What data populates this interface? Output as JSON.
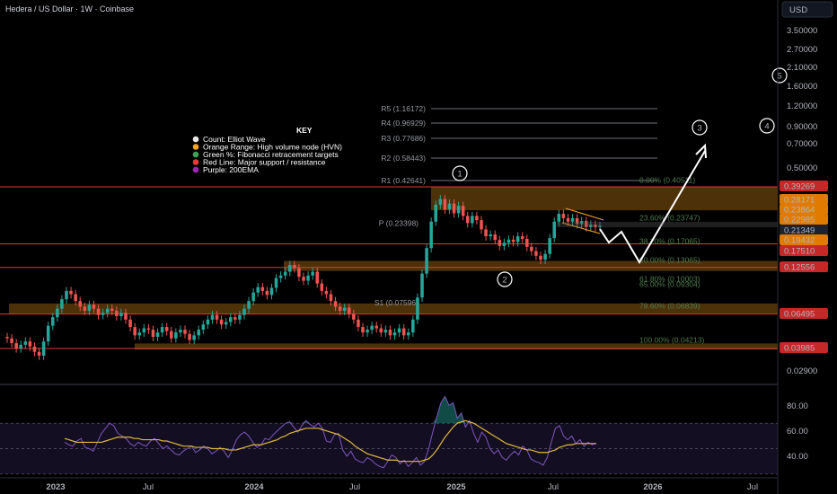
{
  "header": {
    "title": "Hedera / US Dollar · 1W · Coinbase",
    "currency": "USD"
  },
  "chart_data": {
    "type": "candlestick",
    "title": "Hedera / US Dollar · 1W · Coinbase",
    "y_scale": "log",
    "ylim": [
      0.025,
      4.2
    ],
    "x_ticks": [
      "2023",
      "Jul",
      "2024",
      "Jul",
      "2025",
      "Jul",
      "2026",
      "Jul"
    ],
    "y_ticks": [
      "3.50000",
      "2.70000",
      "2.10000",
      "1.60000",
      "1.20000",
      "0.90000",
      "0.70000",
      "0.50000",
      "0.02900"
    ],
    "price_badges": [
      {
        "value": "0.39269",
        "kind": "red"
      },
      {
        "value": "0.28171",
        "kind": "orange"
      },
      {
        "value": "0.23864",
        "kind": "orange"
      },
      {
        "value": "0.22985",
        "kind": "orange"
      },
      {
        "value": "0.21349",
        "kind": "dark"
      },
      {
        "value": "0.19432",
        "kind": "orange"
      },
      {
        "value": "0.17510",
        "kind": "red"
      },
      {
        "value": "0.12556",
        "kind": "red"
      },
      {
        "value": "0.06495",
        "kind": "red"
      },
      {
        "value": "0.03985",
        "kind": "red"
      }
    ],
    "support_resistance_lines": [
      0.39269,
      0.1751,
      0.12556,
      0.06495,
      0.03985
    ],
    "hvn_zones": [
      {
        "from": 0.2817,
        "to": 0.3927
      },
      {
        "from": 0.1194,
        "to": 0.1376
      },
      {
        "from": 0.0653,
        "to": 0.0753
      },
      {
        "from": 0.0392,
        "to": 0.0428
      }
    ],
    "pivot_levels": [
      {
        "label": "R5 (1.16172)",
        "value": 1.16172
      },
      {
        "label": "R4 (0.96929)",
        "value": 0.96929
      },
      {
        "label": "R3 (0.77686)",
        "value": 0.77686
      },
      {
        "label": "R2 (0.58443)",
        "value": 0.58443
      },
      {
        "label": "R1 (0.42641)",
        "value": 0.42641
      },
      {
        "label": "P (0.23398)",
        "value": 0.23398
      },
      {
        "label": "S1 (0.07596)",
        "value": 0.07596
      }
    ],
    "fib_levels": [
      {
        "label": "0.00% (0.40511)",
        "value": 0.40511
      },
      {
        "label": "23.60% (0.23747)",
        "value": 0.23747
      },
      {
        "label": "38.20% (0.17065)",
        "value": 0.17065
      },
      {
        "label": "50.00% (0.13065)",
        "value": 0.13065
      },
      {
        "label": "61.80% (0.10003)",
        "value": 0.10003
      },
      {
        "label": "65.00% (0.09304)",
        "value": 0.09304
      },
      {
        "label": "78.60% (0.06839)",
        "value": 0.06839
      },
      {
        "label": "100.00% (0.04213)",
        "value": 0.04213
      }
    ],
    "wave_labels": [
      "1",
      "2",
      "3",
      "4",
      "5"
    ],
    "key": {
      "title": "KEY",
      "items": [
        {
          "label": "Count: Elliot Wave",
          "color": "#e8e8e8"
        },
        {
          "label": "Orange Range: High volume node (HVN)",
          "color": "#f5a623"
        },
        {
          "label": "Green %: Fibonacci retracement targets",
          "color": "#3aa655"
        },
        {
          "label": "Red Line: Major support / resistance",
          "color": "#e53935"
        },
        {
          "label": "Purple: 200EMA",
          "color": "#9c27b0"
        }
      ]
    },
    "candles_close": [
      0.046,
      0.043,
      0.04,
      0.042,
      0.044,
      0.041,
      0.038,
      0.036,
      0.044,
      0.055,
      0.062,
      0.07,
      0.08,
      0.09,
      0.086,
      0.078,
      0.072,
      0.068,
      0.074,
      0.07,
      0.064,
      0.066,
      0.07,
      0.068,
      0.063,
      0.066,
      0.06,
      0.054,
      0.048,
      0.05,
      0.053,
      0.052,
      0.047,
      0.05,
      0.054,
      0.051,
      0.046,
      0.05,
      0.052,
      0.049,
      0.045,
      0.048,
      0.052,
      0.056,
      0.06,
      0.064,
      0.06,
      0.056,
      0.058,
      0.062,
      0.06,
      0.064,
      0.07,
      0.078,
      0.088,
      0.095,
      0.09,
      0.085,
      0.094,
      0.108,
      0.112,
      0.118,
      0.13,
      0.124,
      0.11,
      0.104,
      0.112,
      0.118,
      0.1,
      0.09,
      0.086,
      0.078,
      0.072,
      0.068,
      0.071,
      0.065,
      0.06,
      0.054,
      0.05,
      0.052,
      0.055,
      0.053,
      0.05,
      0.052,
      0.048,
      0.05,
      0.053,
      0.048,
      0.05,
      0.06,
      0.082,
      0.115,
      0.165,
      0.24,
      0.305,
      0.33,
      0.285,
      0.31,
      0.27,
      0.3,
      0.26,
      0.235,
      0.26,
      0.245,
      0.215,
      0.195,
      0.2,
      0.185,
      0.17,
      0.178,
      0.186,
      0.18,
      0.195,
      0.188,
      0.168,
      0.158,
      0.148,
      0.14,
      0.152,
      0.19,
      0.24,
      0.268,
      0.252,
      0.24,
      0.252,
      0.232,
      0.242,
      0.222,
      0.23,
      0.222,
      0.226
    ],
    "rsi": {
      "ylim": [
        32,
        92
      ],
      "y_ticks": [
        "80.00",
        "60.00",
        "40.00"
      ],
      "values": [
        55,
        53,
        52,
        56,
        58,
        51,
        50,
        48,
        55,
        62,
        66,
        70,
        68,
        62,
        60,
        58,
        54,
        52,
        55,
        53,
        52,
        56,
        58,
        54,
        50,
        52,
        49,
        46,
        45,
        48,
        50,
        52,
        47,
        49,
        52,
        50,
        46,
        48,
        51,
        48,
        43,
        49,
        57,
        61,
        63,
        60,
        55,
        51,
        53,
        58,
        57,
        61,
        64,
        67,
        70,
        71,
        67,
        63,
        68,
        72,
        69,
        67,
        70,
        66,
        56,
        55,
        61,
        62,
        49,
        44,
        48,
        42,
        40,
        39,
        43,
        41,
        38,
        36,
        35,
        40,
        45,
        43,
        38,
        41,
        36,
        39,
        43,
        37,
        40,
        50,
        63,
        75,
        86,
        91,
        84,
        86,
        74,
        78,
        67,
        72,
        62,
        55,
        63,
        59,
        50,
        46,
        49,
        43,
        41,
        45,
        48,
        45,
        52,
        49,
        42,
        40,
        39,
        37,
        43,
        55,
        66,
        68,
        60,
        57,
        60,
        54,
        57,
        52,
        55,
        53,
        54
      ],
      "ma_values": [
        58,
        57,
        56,
        55,
        55,
        55,
        55,
        55,
        55,
        55,
        56,
        57,
        58,
        59,
        59,
        59,
        59,
        58,
        58,
        57,
        57,
        57,
        57,
        57,
        56,
        56,
        55,
        54,
        53,
        52,
        52,
        52,
        51,
        51,
        51,
        51,
        50,
        50,
        50,
        50,
        49,
        49,
        49,
        50,
        51,
        52,
        53,
        53,
        53,
        54,
        55,
        56,
        57,
        59,
        60,
        62,
        63,
        64,
        65,
        66,
        66,
        66,
        66,
        65,
        64,
        63,
        62,
        61,
        59,
        57,
        55,
        52,
        50,
        48,
        46,
        45,
        44,
        43,
        42,
        41,
        41,
        41,
        40,
        40,
        40,
        40,
        40,
        40,
        41,
        42,
        45,
        49,
        54,
        59,
        63,
        67,
        70,
        71,
        72,
        71,
        70,
        68,
        66,
        64,
        62,
        60,
        58,
        56,
        54,
        53,
        52,
        51,
        50,
        49,
        49,
        48,
        47,
        47,
        47,
        48,
        49,
        51,
        52,
        53,
        53,
        54,
        54,
        54,
        54,
        54,
        54
      ]
    }
  }
}
